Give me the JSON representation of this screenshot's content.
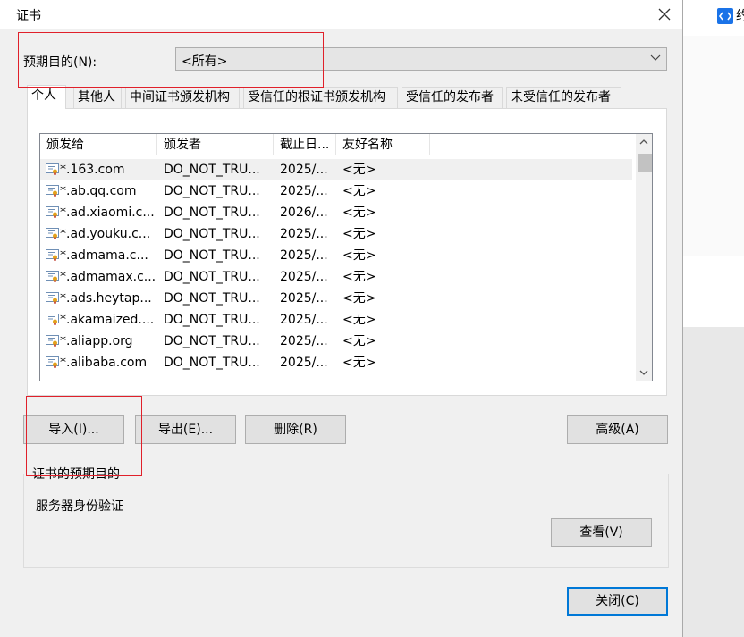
{
  "dialog": {
    "title": "证书",
    "purpose_label": "预期目的(N):",
    "purpose_value": "<所有>",
    "tabs": [
      "个人",
      "其他人",
      "中间证书颁发机构",
      "受信任的根证书颁发机构",
      "受信任的发布者",
      "未受信任的发布者"
    ],
    "active_tab": "个人",
    "columns": [
      "颁发给",
      "颁发者",
      "截止日...",
      "友好名称"
    ],
    "rows": [
      {
        "issued_to": "*.163.com",
        "issuer": "DO_NOT_TRU...",
        "expires": "2025/...",
        "name": "<无>"
      },
      {
        "issued_to": "*.ab.qq.com",
        "issuer": "DO_NOT_TRU...",
        "expires": "2025/...",
        "name": "<无>"
      },
      {
        "issued_to": "*.ad.xiaomi.c...",
        "issuer": "DO_NOT_TRU...",
        "expires": "2026/...",
        "name": "<无>"
      },
      {
        "issued_to": "*.ad.youku.c...",
        "issuer": "DO_NOT_TRU...",
        "expires": "2025/...",
        "name": "<无>"
      },
      {
        "issued_to": "*.admama.c...",
        "issuer": "DO_NOT_TRU...",
        "expires": "2025/...",
        "name": "<无>"
      },
      {
        "issued_to": "*.admamax.c...",
        "issuer": "DO_NOT_TRU...",
        "expires": "2025/...",
        "name": "<无>"
      },
      {
        "issued_to": "*.ads.heytap...",
        "issuer": "DO_NOT_TRU...",
        "expires": "2025/...",
        "name": "<无>"
      },
      {
        "issued_to": "*.akamaized....",
        "issuer": "DO_NOT_TRU...",
        "expires": "2025/...",
        "name": "<无>"
      },
      {
        "issued_to": "*.aliapp.org",
        "issuer": "DO_NOT_TRU...",
        "expires": "2025/...",
        "name": "<无>"
      },
      {
        "issued_to": "*.alibaba.com",
        "issuer": "DO_NOT_TRU...",
        "expires": "2025/...",
        "name": "<无>"
      }
    ],
    "buttons": {
      "import": "导入(I)...",
      "export": "导出(E)...",
      "remove": "删除(R)",
      "advanced": "高级(A)",
      "view": "查看(V)",
      "close": "关闭(C)"
    },
    "purposes_group_label": "证书的预期目的",
    "purposes_value": "服务器身份验证"
  },
  "background": {
    "partial_glyph": "约"
  },
  "colors": {
    "highlight_box": "#e0202a",
    "accent": "#0078d7"
  }
}
